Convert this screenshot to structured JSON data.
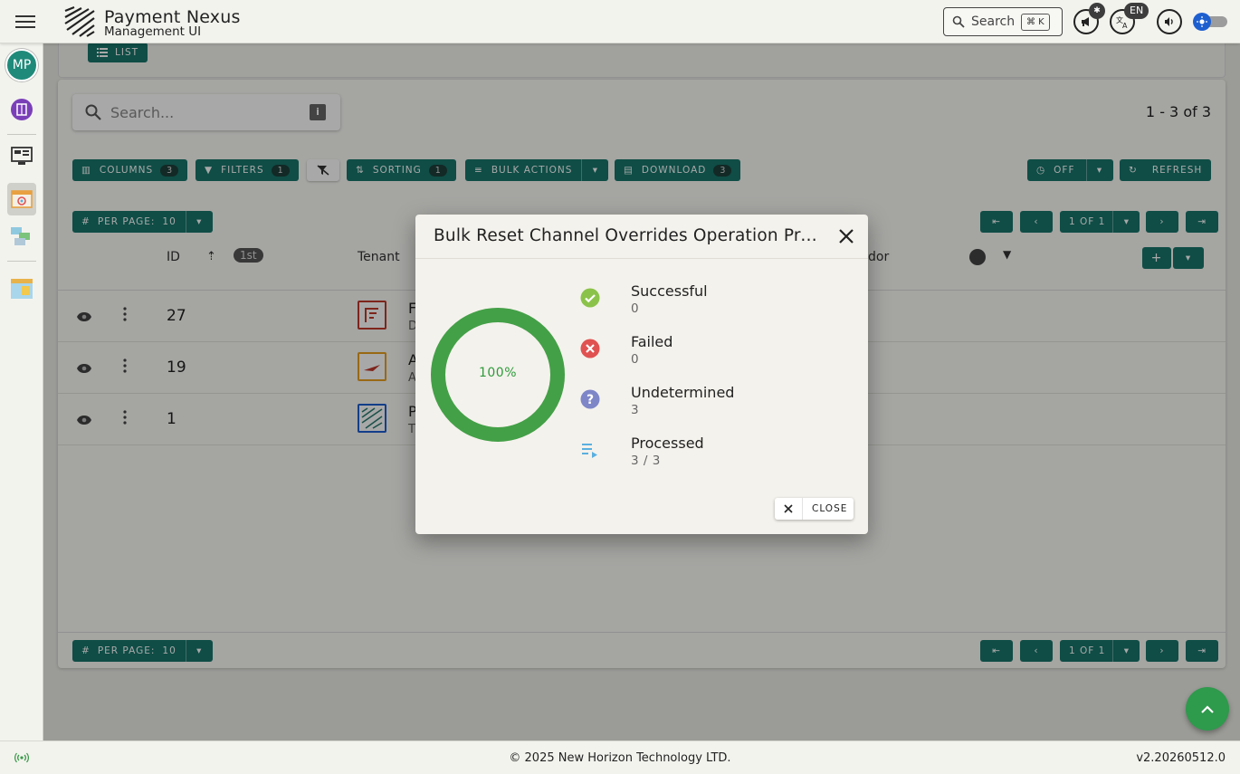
{
  "app": {
    "title": "Payment Nexus",
    "subtitle": "Management UI",
    "search_label": "Search",
    "search_shortcut": "⌘ K",
    "notification_count": "✱",
    "language": "EN",
    "user_initials": "MP"
  },
  "topcard": {
    "list_label": "LIST"
  },
  "table": {
    "search_placeholder": "Search...",
    "range_text": "1 - 3 of 3",
    "toolbar": {
      "columns_label": "COLUMNS",
      "columns_count": "3",
      "filters_label": "FILTERS",
      "filters_count": "1",
      "sorting_label": "SORTING",
      "sorting_count": "1",
      "bulk_label": "BULK ACTIONS",
      "download_label": "DOWNLOAD",
      "download_count": "3",
      "off_label": "OFF",
      "refresh_label": "REFRESH"
    },
    "per_page_label": "PER PAGE:",
    "per_page_value": "10",
    "page_label": "1 OF 1",
    "headers": {
      "id": "ID",
      "sort_badge": "1st",
      "tenant": "Tenant",
      "vendor": "dor"
    },
    "rows": [
      {
        "id": "27",
        "tenant": "F",
        "tenant_sub": "D"
      },
      {
        "id": "19",
        "tenant": "A",
        "tenant_sub": "A"
      },
      {
        "id": "1",
        "tenant": "P",
        "tenant_sub": "T"
      }
    ]
  },
  "dialog": {
    "title": "Bulk Reset Channel Overrides Operation Progress",
    "progress_text": "100%",
    "progress_value": 1.0,
    "stats": [
      {
        "label": "Successful",
        "value": "0"
      },
      {
        "label": "Failed",
        "value": "0"
      },
      {
        "label": "Undetermined",
        "value": "3"
      },
      {
        "label": "Processed",
        "value": "3 / 3"
      }
    ],
    "close_label": "CLOSE"
  },
  "footer": {
    "copyright": "© 2025 New Horizon Technology LTD.",
    "version": "v2.20260512.0"
  },
  "colors": {
    "teal": "#17766b",
    "success": "#8bc34a",
    "failed": "#e05252",
    "undetermined": "#7e86c8",
    "processed": "#5ab0e0",
    "ring": "#43a047"
  }
}
